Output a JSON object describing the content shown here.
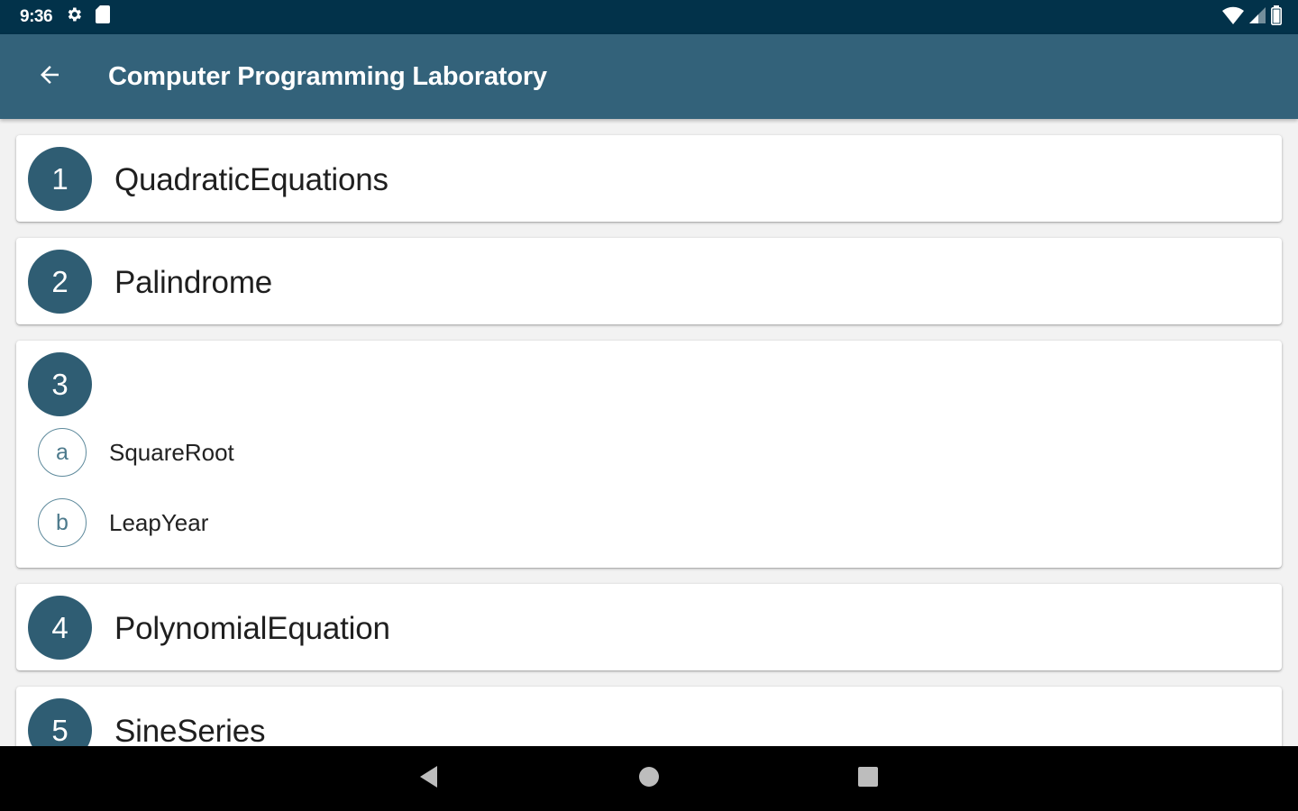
{
  "status_bar": {
    "time": "9:36",
    "icons_left": [
      "gear-icon",
      "sd-card-icon"
    ],
    "icons_right": [
      "wifi-icon",
      "signal-icon",
      "battery-icon"
    ]
  },
  "app_bar": {
    "back_icon": "arrow-back-icon",
    "title": "Computer Programming Laboratory"
  },
  "programs": [
    {
      "number": "1",
      "label": "QuadraticEquations"
    },
    {
      "number": "2",
      "label": "Palindrome"
    },
    {
      "number": "3",
      "label": "",
      "sub_items": [
        {
          "letter": "a",
          "label": "SquareRoot"
        },
        {
          "letter": "b",
          "label": "LeapYear"
        }
      ]
    },
    {
      "number": "4",
      "label": "PolynomialEquation"
    },
    {
      "number": "5",
      "label": "SineSeries"
    }
  ],
  "nav_bar": {
    "buttons": [
      "back-triangle-icon",
      "home-circle-icon",
      "recents-square-icon"
    ]
  },
  "colors": {
    "status_bar": "#02324a",
    "app_bar": "#33627a",
    "accent_circle": "#2f5d73"
  }
}
